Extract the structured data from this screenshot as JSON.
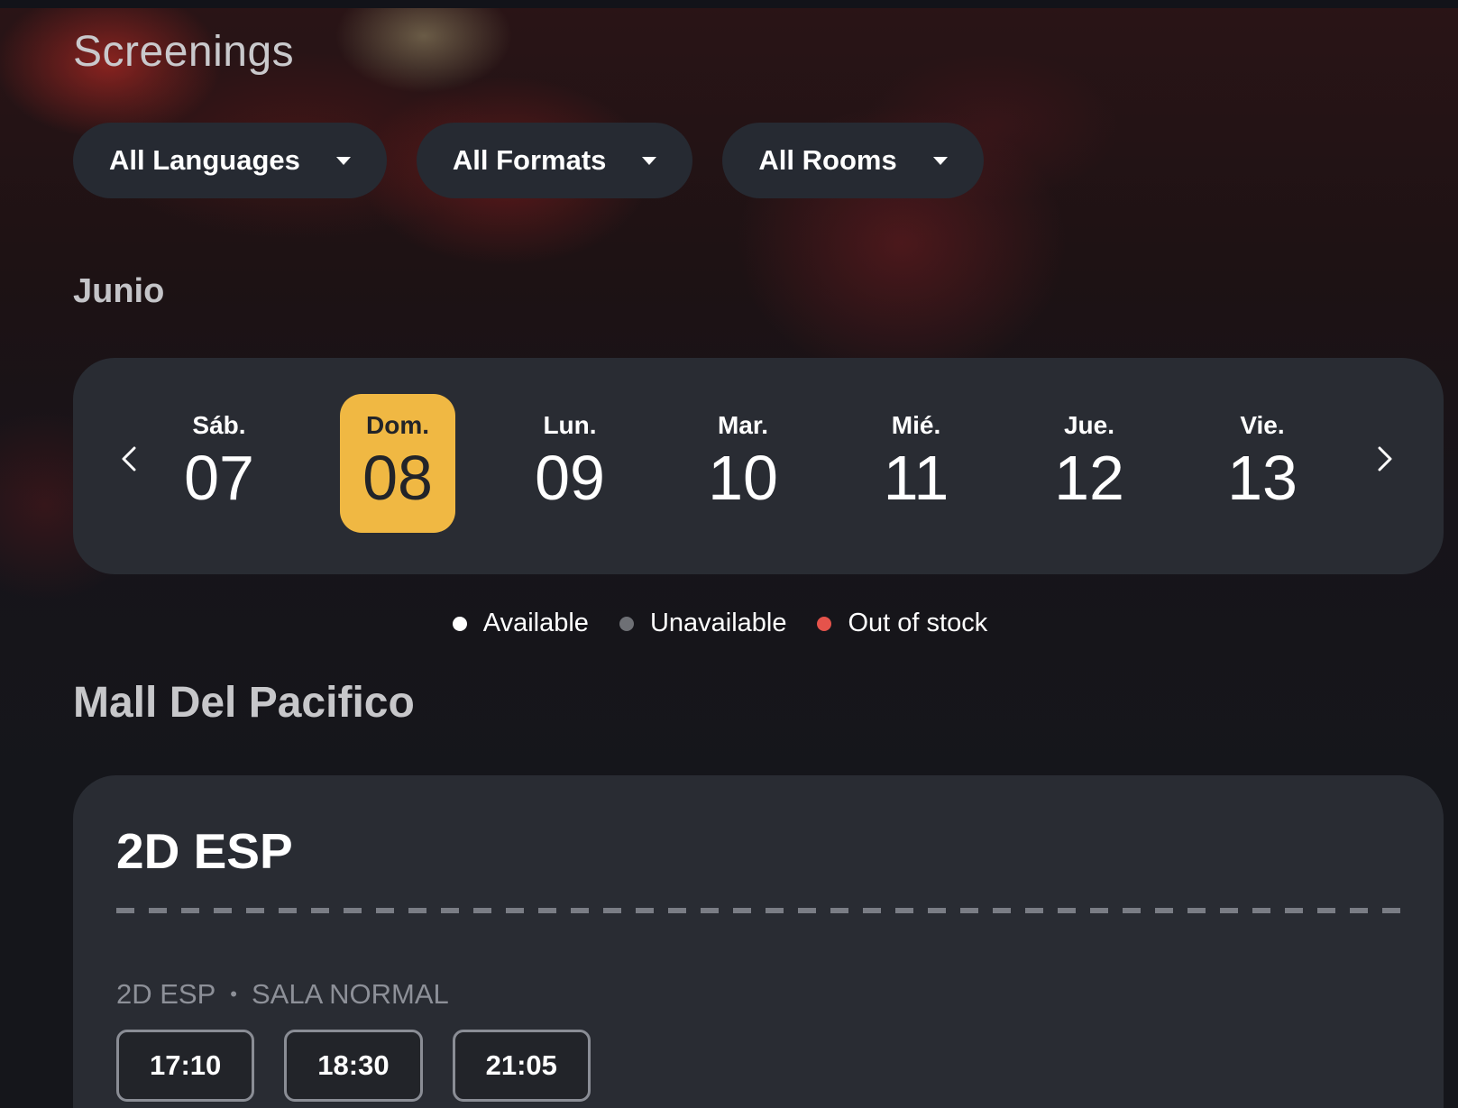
{
  "page": {
    "title": "Screenings"
  },
  "filters": [
    {
      "label": "All Languages"
    },
    {
      "label": "All Formats"
    },
    {
      "label": "All Rooms"
    }
  ],
  "calendar": {
    "month": "Junio",
    "days": [
      {
        "dow": "Sáb.",
        "num": "07",
        "selected": false
      },
      {
        "dow": "Dom.",
        "num": "08",
        "selected": true
      },
      {
        "dow": "Lun.",
        "num": "09",
        "selected": false
      },
      {
        "dow": "Mar.",
        "num": "10",
        "selected": false
      },
      {
        "dow": "Mié.",
        "num": "11",
        "selected": false
      },
      {
        "dow": "Jue.",
        "num": "12",
        "selected": false
      },
      {
        "dow": "Vie.",
        "num": "13",
        "selected": false
      }
    ],
    "prev_icon": "chevron-left-icon",
    "next_icon": "chevron-right-icon",
    "selected_color": "#f0b843"
  },
  "legend": [
    {
      "label": "Available",
      "color": "#ffffff"
    },
    {
      "label": "Unavailable",
      "color": "#6e7075"
    },
    {
      "label": "Out of stock",
      "color": "#e5534b"
    }
  ],
  "cinema": {
    "name": "Mall Del Pacifico",
    "card": {
      "title": "2D ESP",
      "format": "2D ESP",
      "separator": "•",
      "room": "SALA NORMAL",
      "times": [
        "17:10",
        "18:30",
        "21:05"
      ]
    }
  }
}
